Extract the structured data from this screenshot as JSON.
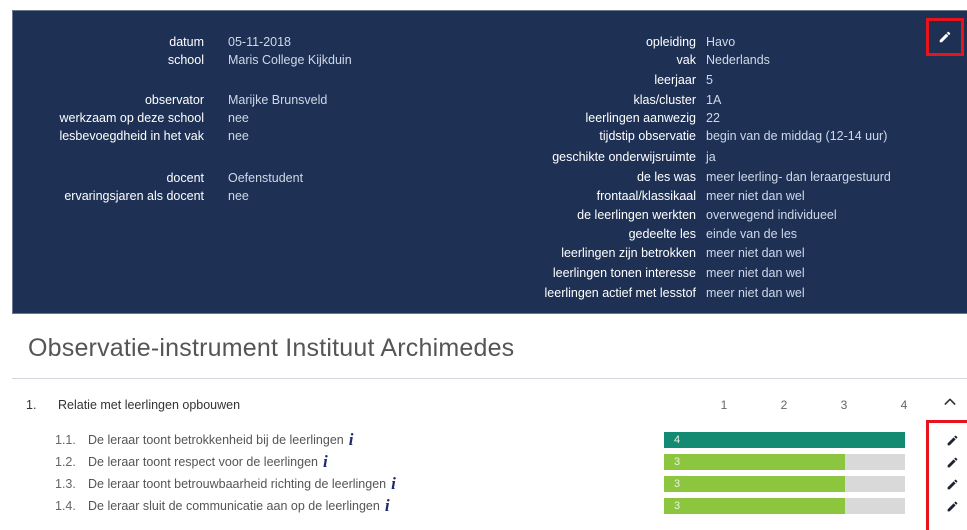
{
  "header": {
    "left_fields": [
      {
        "label": "datum",
        "value": "05-11-2018"
      },
      {
        "label": "school",
        "value": "Maris College Kijkduin"
      },
      {
        "label": "observator",
        "value": "Marijke Brunsveld"
      },
      {
        "label": "werkzaam op deze school",
        "value": "nee"
      },
      {
        "label": "lesbevoegdheid in het vak",
        "value": "nee"
      },
      {
        "label": "docent",
        "value": "Oefenstudent"
      },
      {
        "label": "ervaringsjaren als docent",
        "value": "nee"
      }
    ],
    "right_fields": [
      {
        "label": "opleiding",
        "value": "Havo"
      },
      {
        "label": "vak",
        "value": "Nederlands"
      },
      {
        "label": "leerjaar",
        "value": "5"
      },
      {
        "label": "klas/cluster",
        "value": "1A"
      },
      {
        "label": "leerlingen aanwezig",
        "value": "22"
      },
      {
        "label": "tijdstip observatie",
        "value": "begin van de middag (12-14 uur)"
      },
      {
        "label": "geschikte onderwijsruimte",
        "value": "ja"
      },
      {
        "label": "de les was",
        "value": "meer leerling- dan leraargestuurd"
      },
      {
        "label": "frontaal/klassikaal",
        "value": "meer niet dan wel"
      },
      {
        "label": "de leerlingen werkten",
        "value": "overwegend individueel"
      },
      {
        "label": "gedeelte les",
        "value": "einde van de les"
      },
      {
        "label": "leerlingen zijn betrokken",
        "value": "meer niet dan wel"
      },
      {
        "label": "leerlingen tonen interesse",
        "value": "meer niet dan wel"
      },
      {
        "label": "leerlingen actief met lesstof",
        "value": "meer niet dan wel"
      }
    ],
    "edit_icon": "pencil-icon"
  },
  "title": "Observatie-instrument Instituut Archimedes",
  "section": {
    "number": "1.",
    "title": "Relatie met leerlingen opbouwen",
    "scale": [
      "1",
      "2",
      "3",
      "4"
    ],
    "collapse_icon": "chevron-up-icon"
  },
  "items": [
    {
      "number": "1.1.",
      "text": "De leraar toont betrokkenheid bij de leerlingen",
      "score": 4,
      "score_label": "4",
      "color": "#138a72"
    },
    {
      "number": "1.2.",
      "text": "De leraar toont respect voor de leerlingen",
      "score": 3,
      "score_label": "3",
      "color": "#8cc63f"
    },
    {
      "number": "1.3.",
      "text": "De leraar toont betrouwbaarheid richting de leerlingen",
      "score": 3,
      "score_label": "3",
      "color": "#8cc63f"
    },
    {
      "number": "1.4.",
      "text": "De leraar sluit de communicatie aan op de leerlingen",
      "score": 3,
      "score_label": "3",
      "color": "#8cc63f"
    }
  ],
  "colors": {
    "panel": "#1e3155",
    "highlight": "#e8141b",
    "bar_track": "#d9d9d9"
  }
}
